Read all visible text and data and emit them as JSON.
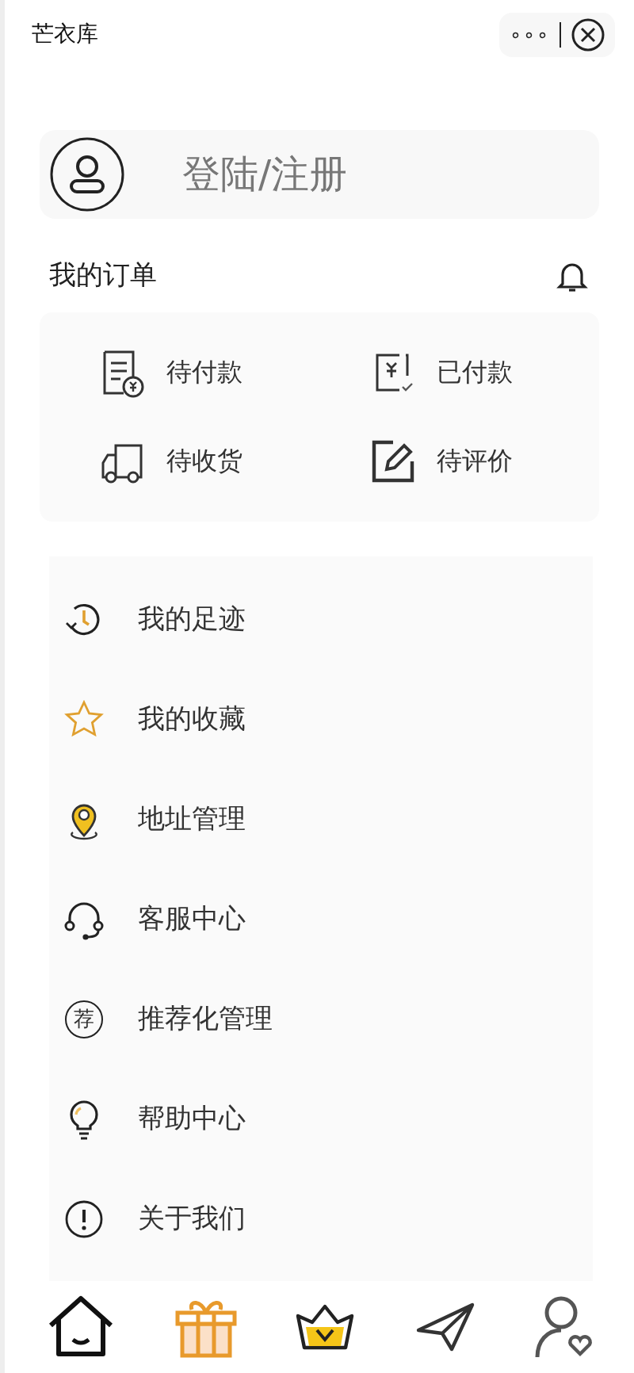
{
  "header": {
    "title": "芒衣库",
    "more": "∘∘∘"
  },
  "login": {
    "label": "登陆/注册"
  },
  "orders": {
    "title": "我的订单",
    "items": [
      {
        "label": "待付款"
      },
      {
        "label": "已付款"
      },
      {
        "label": "待收货"
      },
      {
        "label": "待评价"
      }
    ]
  },
  "menu": [
    {
      "label": "我的足迹"
    },
    {
      "label": "我的收藏"
    },
    {
      "label": "地址管理"
    },
    {
      "label": "客服中心"
    },
    {
      "label": "推荐化管理",
      "icon_text": "荐"
    },
    {
      "label": "帮助中心"
    },
    {
      "label": "关于我们"
    }
  ]
}
